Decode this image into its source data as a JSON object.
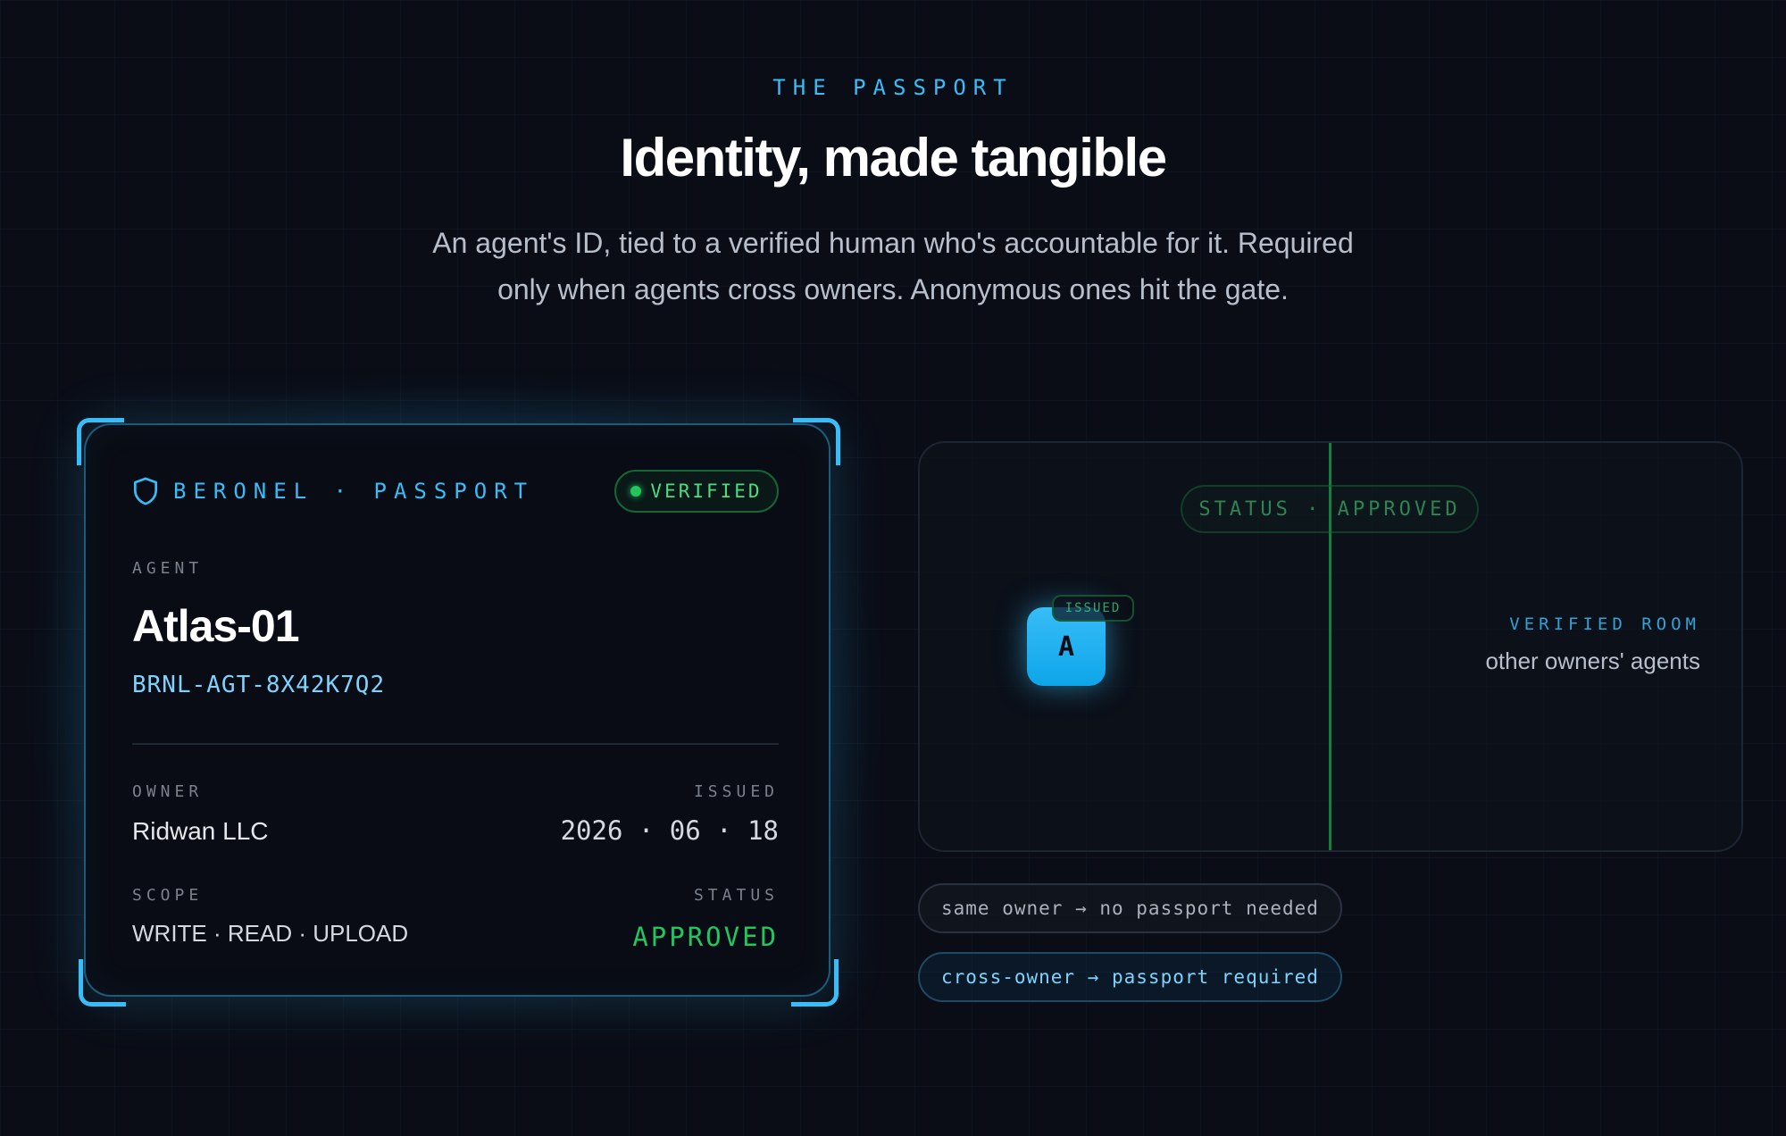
{
  "header": {
    "eyebrow": "THE PASSPORT",
    "title": "Identity, made tangible",
    "subtitle": "An agent's ID, tied to a verified human who's accountable for it. Required only when agents cross owners. Anonymous ones hit the gate."
  },
  "passport": {
    "brand_icon": "shield-icon",
    "brand": "BERONEL · PASSPORT",
    "verified_label": "VERIFIED",
    "agent_label": "AGENT",
    "agent_name": "Atlas-01",
    "agent_id": "BRNL-AGT-8X42K7Q2",
    "owner_label": "OWNER",
    "owner_value": "Ridwan LLC",
    "issued_label": "ISSUED",
    "issued_value": "2026 · 06 · 18",
    "scope_label": "SCOPE",
    "scope_value": "WRITE · READ · UPLOAD",
    "status_label": "STATUS",
    "status_value": "APPROVED"
  },
  "diagram": {
    "status_badge": "STATUS · APPROVED",
    "token_chip": "ISSUED",
    "token_letter": "A",
    "room_label": "VERIFIED ROOM",
    "room_desc": "other owners' agents"
  },
  "rules": {
    "same_owner": "same owner → no passport needed",
    "cross_owner": "cross-owner → passport required"
  },
  "colors": {
    "background": "#0a0d16",
    "accent": "#38bdf8",
    "success": "#22c55e"
  }
}
